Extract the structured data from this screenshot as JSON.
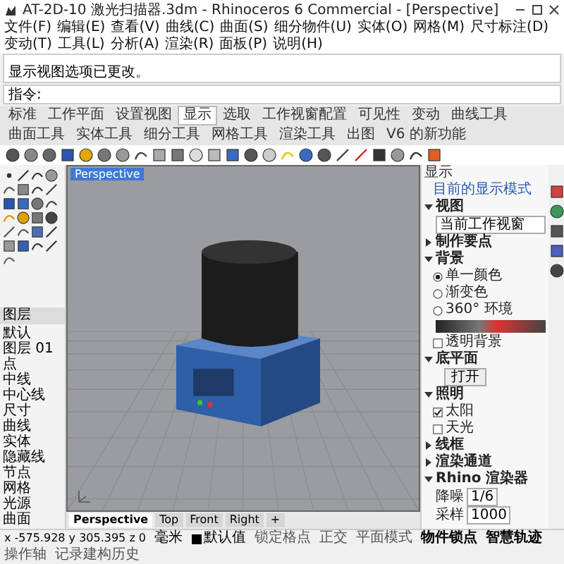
{
  "window": {
    "title": "AT-2D-10 激光扫描器.3dm - Rhinoceros 6 Commercial - [Perspective]"
  },
  "menu": [
    "文件(F)",
    "编辑(E)",
    "查看(V)",
    "曲线(C)",
    "曲面(S)",
    "细分物件(U)",
    "实体(O)",
    "网格(M)",
    "尺寸标注(D)",
    "变动(T)",
    "工具(L)",
    "分析(A)",
    "渲染(R)",
    "面板(P)",
    "说明(H)"
  ],
  "command_history": [
    "显示视图选项已更改。"
  ],
  "command_prompt": "指令:",
  "toolbar_tabs": [
    {
      "label": "标准",
      "selected": false
    },
    {
      "label": "工作平面",
      "selected": false
    },
    {
      "label": "设置视图",
      "selected": false
    },
    {
      "label": "显示",
      "selected": true
    },
    {
      "label": "选取",
      "selected": false
    },
    {
      "label": "工作视窗配置",
      "selected": false
    },
    {
      "label": "可见性",
      "selected": false
    },
    {
      "label": "变动",
      "selected": false
    },
    {
      "label": "曲线工具",
      "selected": false
    },
    {
      "label": "曲面工具",
      "selected": false
    },
    {
      "label": "实体工具",
      "selected": false
    },
    {
      "label": "细分工具",
      "selected": false
    },
    {
      "label": "网格工具",
      "selected": false
    },
    {
      "label": "渲染工具",
      "selected": false
    },
    {
      "label": "出图",
      "selected": false
    },
    {
      "label": "V6 的新功能",
      "selected": false
    }
  ],
  "layers_panel": {
    "title": "图层",
    "items": [
      "默认",
      "图层 01",
      "点",
      "中线",
      "中心线",
      "尺寸",
      "曲线",
      "实体",
      "隐藏线",
      "节点",
      "网格",
      "光源",
      "曲面"
    ]
  },
  "viewport": {
    "title": "Perspective"
  },
  "viewport_tabs": [
    {
      "label": "Perspective",
      "selected": true
    },
    {
      "label": "Top",
      "selected": false
    },
    {
      "label": "Front",
      "selected": false
    },
    {
      "label": "Right",
      "selected": false
    },
    {
      "label": "+",
      "selected": false
    }
  ],
  "display_panel": {
    "title": "显示",
    "sections": [
      {
        "kind": "link",
        "label": "目前的显示模式"
      },
      {
        "kind": "header",
        "label": "视图",
        "expanded": true
      },
      {
        "kind": "dropdown",
        "value": "当前工作视窗"
      },
      {
        "kind": "header",
        "label": "制作要点",
        "expanded": false
      },
      {
        "kind": "header",
        "label": "背景",
        "expanded": true
      },
      {
        "kind": "radio",
        "label": "单一颜色",
        "selected": true
      },
      {
        "kind": "radio",
        "label": "渐变色",
        "selected": false
      },
      {
        "kind": "radio",
        "label": "360° 环境",
        "selected": false
      },
      {
        "kind": "swatch"
      },
      {
        "kind": "check",
        "label": "透明背景",
        "checked": false
      },
      {
        "kind": "header",
        "label": "底平面",
        "expanded": true
      },
      {
        "kind": "button",
        "label": "打开"
      },
      {
        "kind": "header",
        "label": "照明",
        "expanded": true
      },
      {
        "kind": "check",
        "label": "太阳",
        "checked": true
      },
      {
        "kind": "check",
        "label": "天光",
        "checked": false
      },
      {
        "kind": "header",
        "label": "线框",
        "expanded": false
      },
      {
        "kind": "header",
        "label": "渲染通道",
        "expanded": false
      },
      {
        "kind": "header",
        "label": "Rhino 渲染器",
        "expanded": true
      },
      {
        "kind": "field",
        "label": "降噪",
        "value": "1/6"
      },
      {
        "kind": "field",
        "label": "采样",
        "value": "1000"
      }
    ]
  },
  "status_bar": {
    "coordinates": "x -575.928  y 305.395  z 0",
    "unit": "毫米",
    "layer": "默认值",
    "toggles": [
      {
        "label": "锁定格点",
        "on": false
      },
      {
        "label": "正交",
        "on": false
      },
      {
        "label": "平面模式",
        "on": false
      },
      {
        "label": "物件锁点",
        "on": true
      },
      {
        "label": "智慧轨迹",
        "on": true
      },
      {
        "label": "操作轴",
        "on": false
      },
      {
        "label": "记录建构历史",
        "on": false
      }
    ]
  }
}
